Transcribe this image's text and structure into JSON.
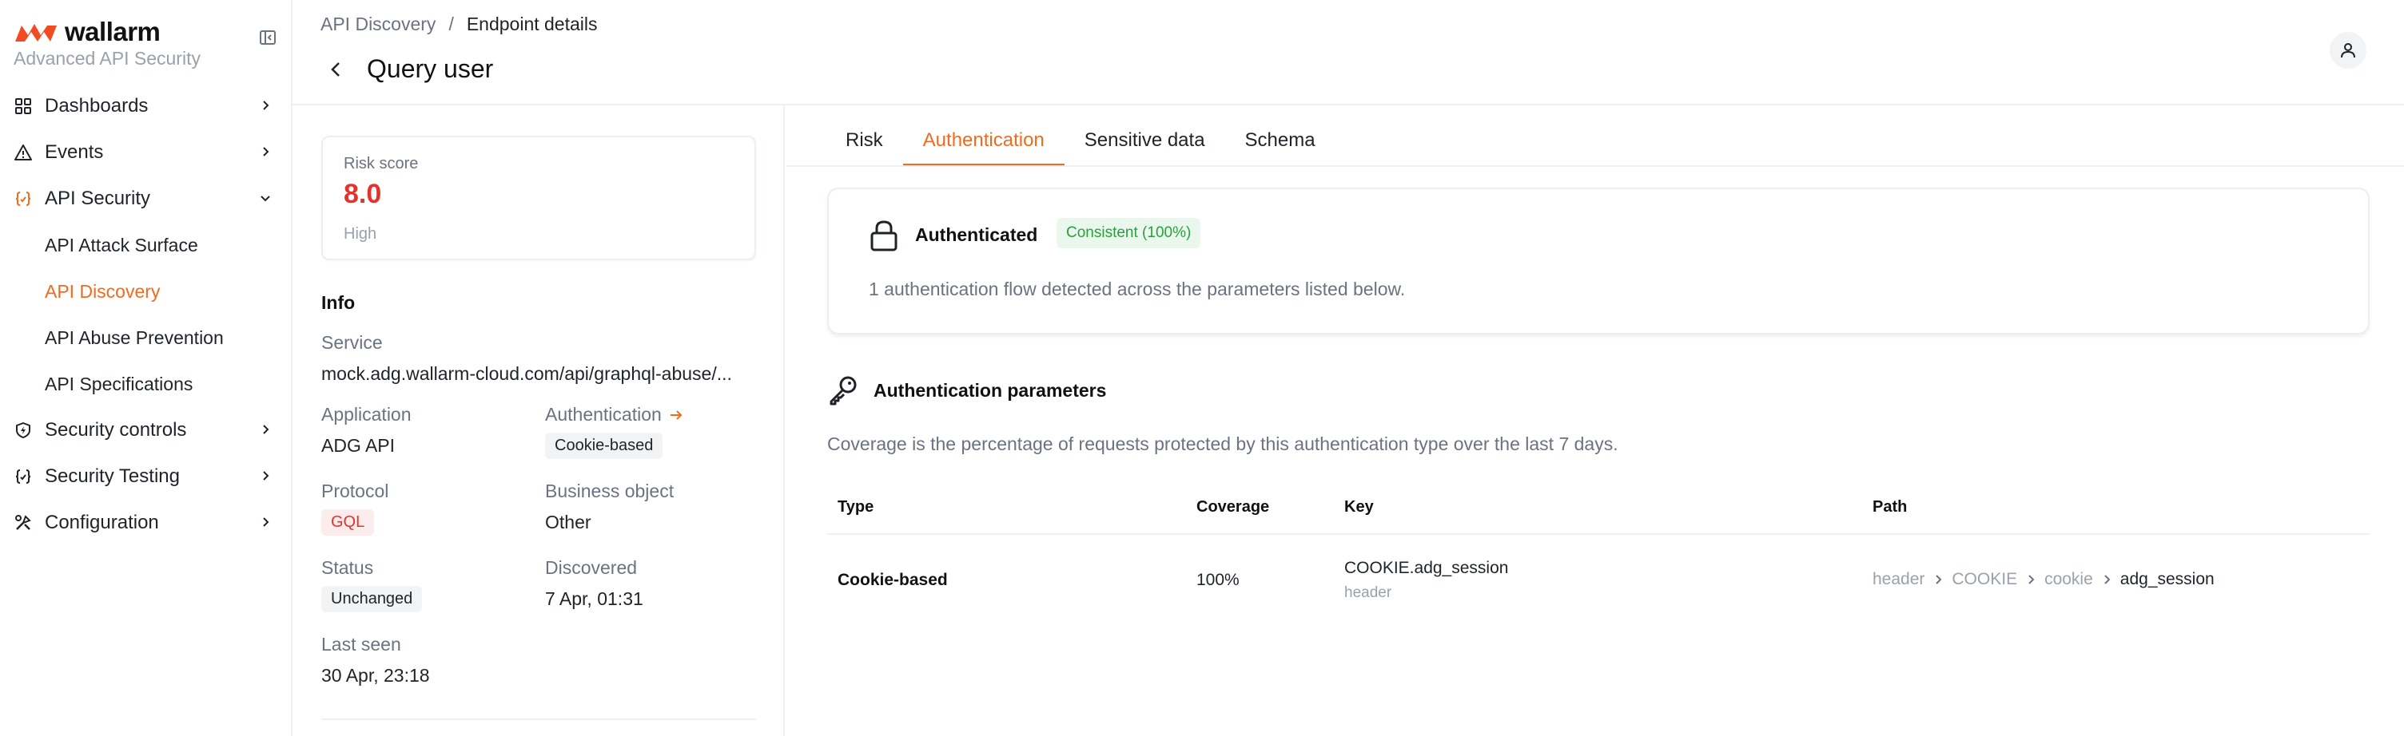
{
  "brand": {
    "name": "wallarm",
    "subtitle": "Advanced API Security",
    "accent": "#f26b1d"
  },
  "sidebar": {
    "items": [
      {
        "label": "Dashboards",
        "icon": "grid-icon"
      },
      {
        "label": "Events",
        "icon": "warning-triangle-icon"
      },
      {
        "label": "API Security",
        "icon": "code-braces-icon",
        "expanded": true,
        "children": [
          {
            "label": "API Attack Surface"
          },
          {
            "label": "API Discovery",
            "current": true
          },
          {
            "label": "API Abuse Prevention"
          },
          {
            "label": "API Specifications"
          }
        ]
      },
      {
        "label": "Security controls",
        "icon": "shield-icon"
      },
      {
        "label": "Security Testing",
        "icon": "code-braces-icon"
      },
      {
        "label": "Configuration",
        "icon": "tools-icon"
      }
    ]
  },
  "header": {
    "breadcrumb": [
      "API Discovery",
      "/",
      "Endpoint details"
    ],
    "title": "Query user"
  },
  "info": {
    "risk": {
      "label": "Risk score",
      "value": "8.0",
      "level": "High",
      "color": "#e5322b"
    },
    "section_title": "Info",
    "service_label": "Service",
    "service_value": "mock.adg.wallarm-cloud.com/api/graphql-abuse/...",
    "application_label": "Application",
    "application_value": "ADG API",
    "authentication_label": "Authentication",
    "authentication_value": "Cookie-based",
    "protocol_label": "Protocol",
    "protocol_value": "GQL",
    "business_object_label": "Business object",
    "business_object_value": "Other",
    "status_label": "Status",
    "status_value": "Unchanged",
    "discovered_label": "Discovered",
    "discovered_value": "7 Apr, 01:31",
    "last_seen_label": "Last seen",
    "last_seen_value": "30 Apr, 23:18"
  },
  "tabs": [
    {
      "label": "Risk"
    },
    {
      "label": "Authentication",
      "active": true
    },
    {
      "label": "Sensitive data"
    },
    {
      "label": "Schema"
    }
  ],
  "auth": {
    "title": "Authenticated",
    "badge": "Consistent (100%)",
    "description": "1 authentication flow detected across the parameters listed below.",
    "params_title": "Authentication parameters",
    "params_description": "Coverage is the percentage of requests protected by this authentication type over the last 7 days.",
    "table": {
      "headers": [
        "Type",
        "Coverage",
        "Key",
        "Path"
      ],
      "rows": [
        {
          "type": "Cookie-based",
          "coverage": "100%",
          "key": "COOKIE.adg_session",
          "key_sub": "header",
          "path": [
            "header",
            "COOKIE",
            "cookie",
            "adg_session"
          ]
        }
      ]
    }
  }
}
